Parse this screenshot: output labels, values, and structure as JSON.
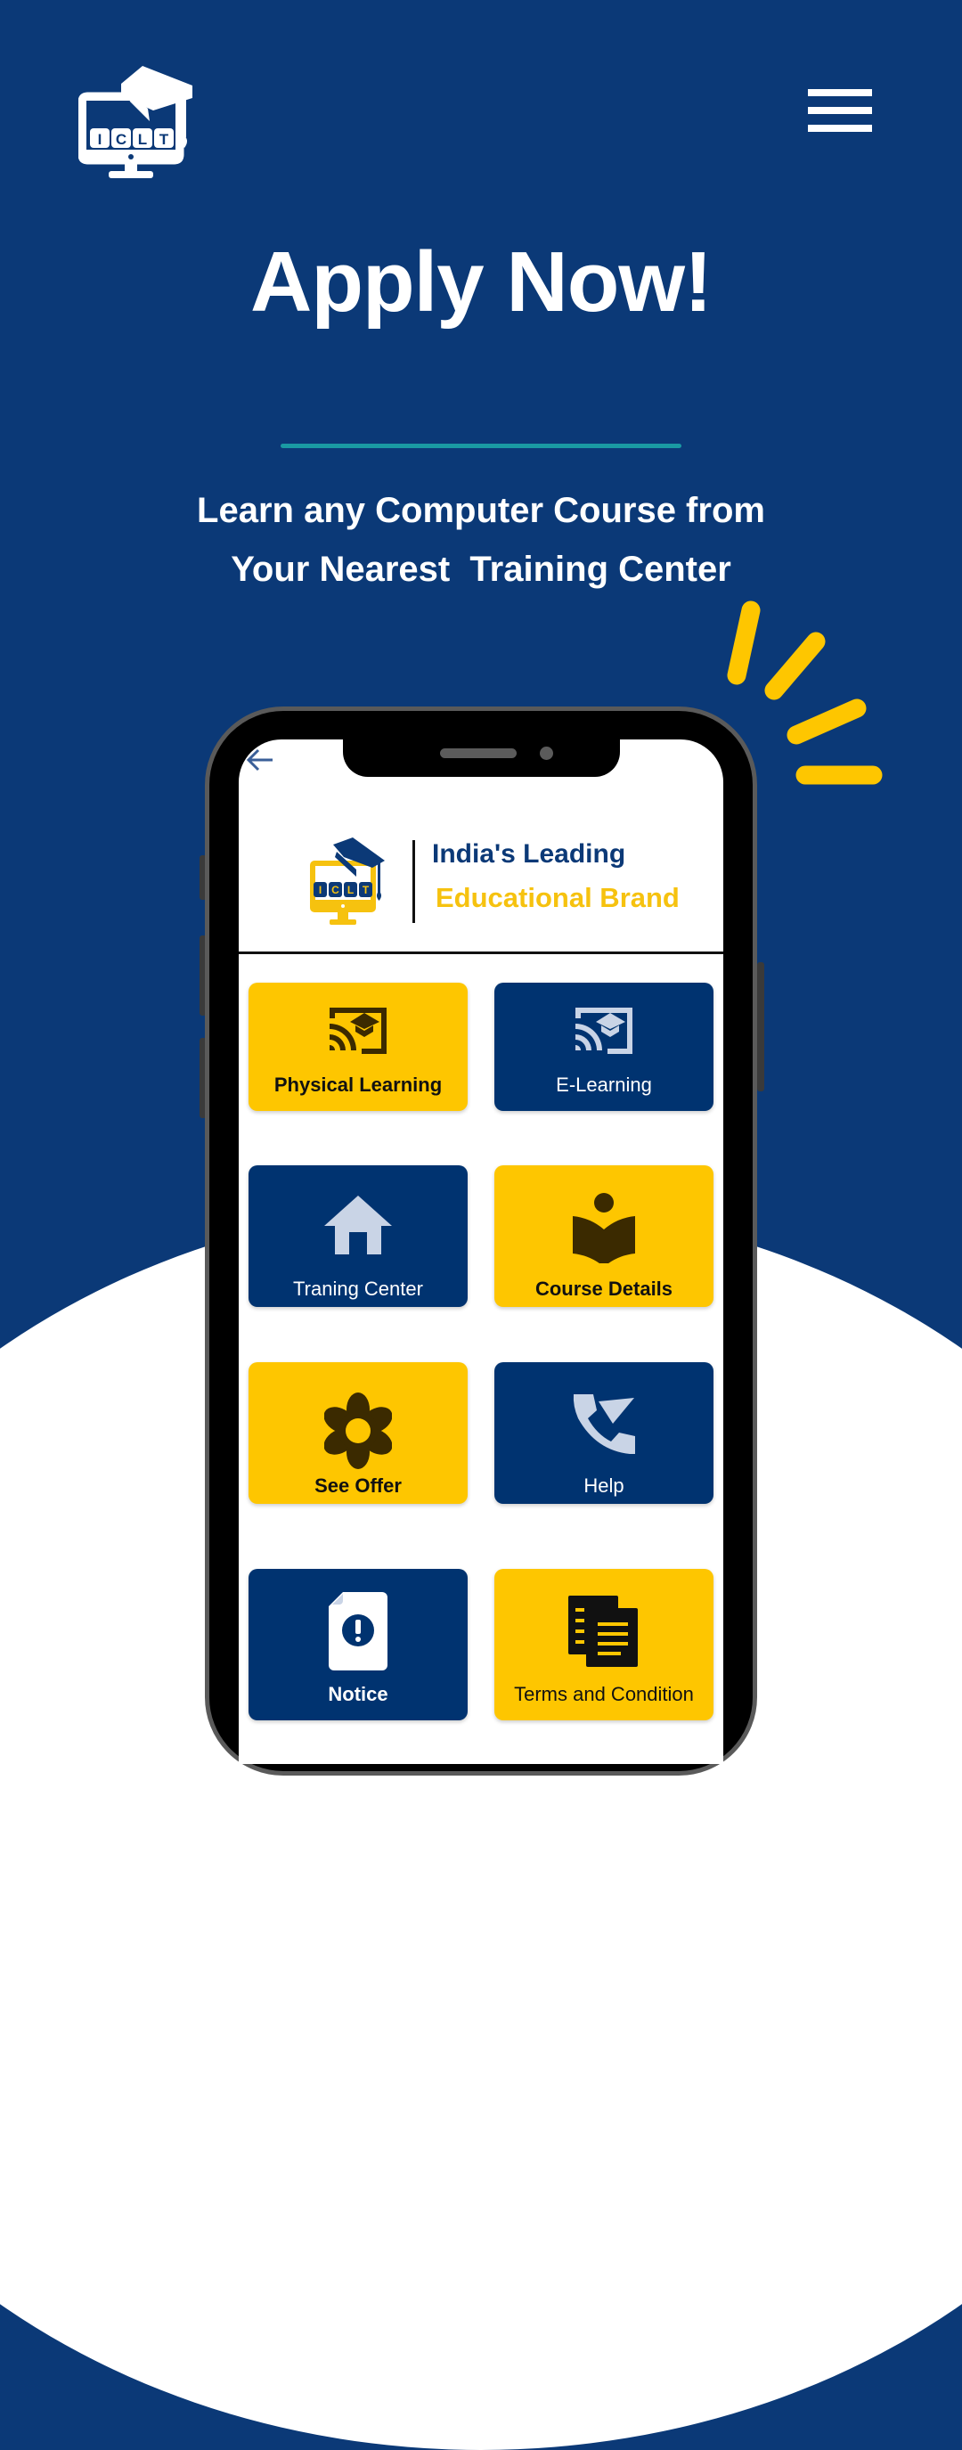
{
  "header": {
    "logo_text": "ICLT",
    "menu_icon": "hamburger-menu-icon"
  },
  "hero": {
    "title": "Apply Now!",
    "subtitle_line1": "Learn any Computer Course from",
    "subtitle_line2": "Your Nearest  Training Center"
  },
  "phone": {
    "back_icon": "arrow-left-icon",
    "brand": {
      "logo_text": "ICLT",
      "line1": "India's Leading",
      "line2": "Educational Brand"
    },
    "menu": [
      {
        "label": "Physical Learning",
        "icon": "cast-for-education-icon",
        "style": "yellow",
        "bold": true
      },
      {
        "label": "E-Learning",
        "icon": "cast-for-education-icon",
        "style": "navy",
        "bold": false
      },
      {
        "label": "Traning Center",
        "icon": "home-icon",
        "style": "navy",
        "bold": false
      },
      {
        "label": "Course Details",
        "icon": "local-library-icon",
        "style": "yellow",
        "bold": true
      },
      {
        "label": "See Offer",
        "icon": "flower-icon",
        "style": "yellow",
        "bold": true
      },
      {
        "label": "Help",
        "icon": "phone-callback-icon",
        "style": "navy",
        "bold": false
      },
      {
        "label": "Notice",
        "icon": "document-alert-icon",
        "style": "navy",
        "bold": true
      },
      {
        "label": "Terms and Condition",
        "icon": "documents-icon",
        "style": "yellow",
        "bold": false
      }
    ]
  },
  "colors": {
    "background": "#0b3977",
    "accent_yellow": "#fec600",
    "card_navy": "#003370",
    "divider_teal": "#1a9aa3"
  }
}
